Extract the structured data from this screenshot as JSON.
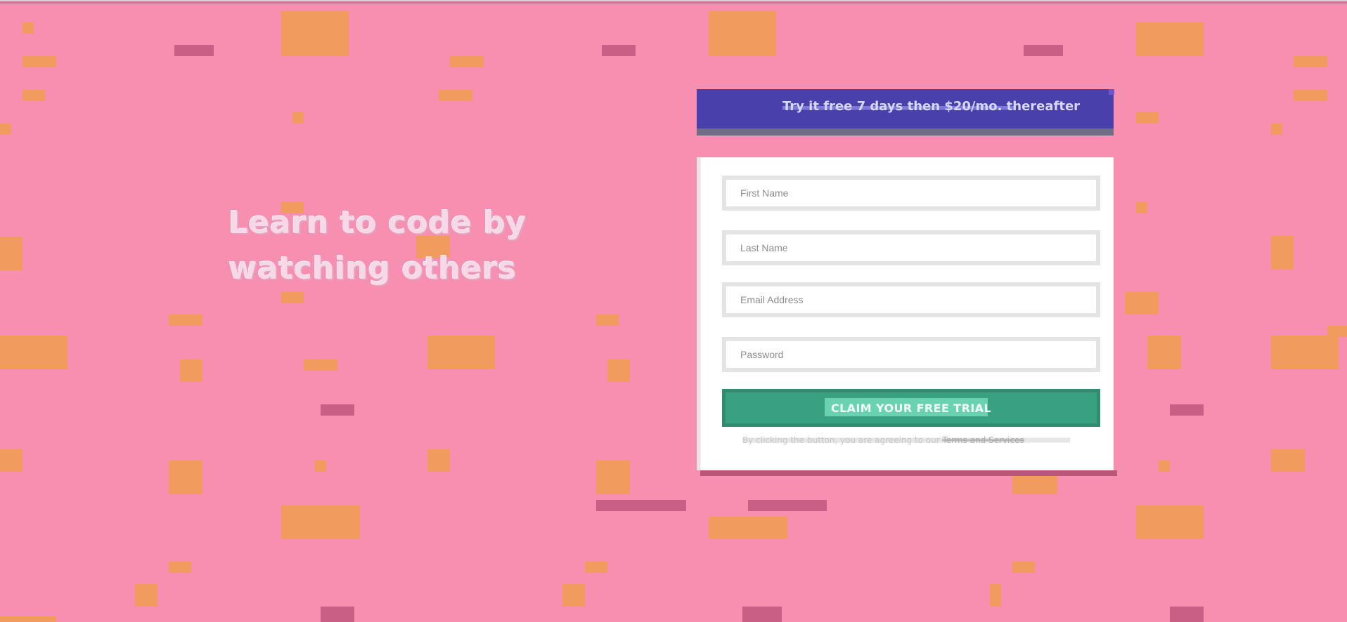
{
  "hero": {
    "headline_lines": [
      "Learn to code by",
      "watching others"
    ]
  },
  "promo": {
    "text": "Try it free 7 days then $20/mo. thereafter"
  },
  "form": {
    "fields": [
      {
        "placeholder": "First Name"
      },
      {
        "placeholder": "Last Name"
      },
      {
        "placeholder": "Email Address"
      },
      {
        "placeholder": "Password"
      }
    ],
    "submit_label": "CLAIM YOUR FREE TRIAL",
    "terms_prefix": "By clicking the button, you are agreeing to our ",
    "terms_link": "Terms and Services"
  },
  "theme": {
    "background": "#f78fb0",
    "banner": "#4a40ab",
    "button": "#38a181",
    "accent_orange": "#f29b5e",
    "accent_rose": "#c85f85"
  }
}
